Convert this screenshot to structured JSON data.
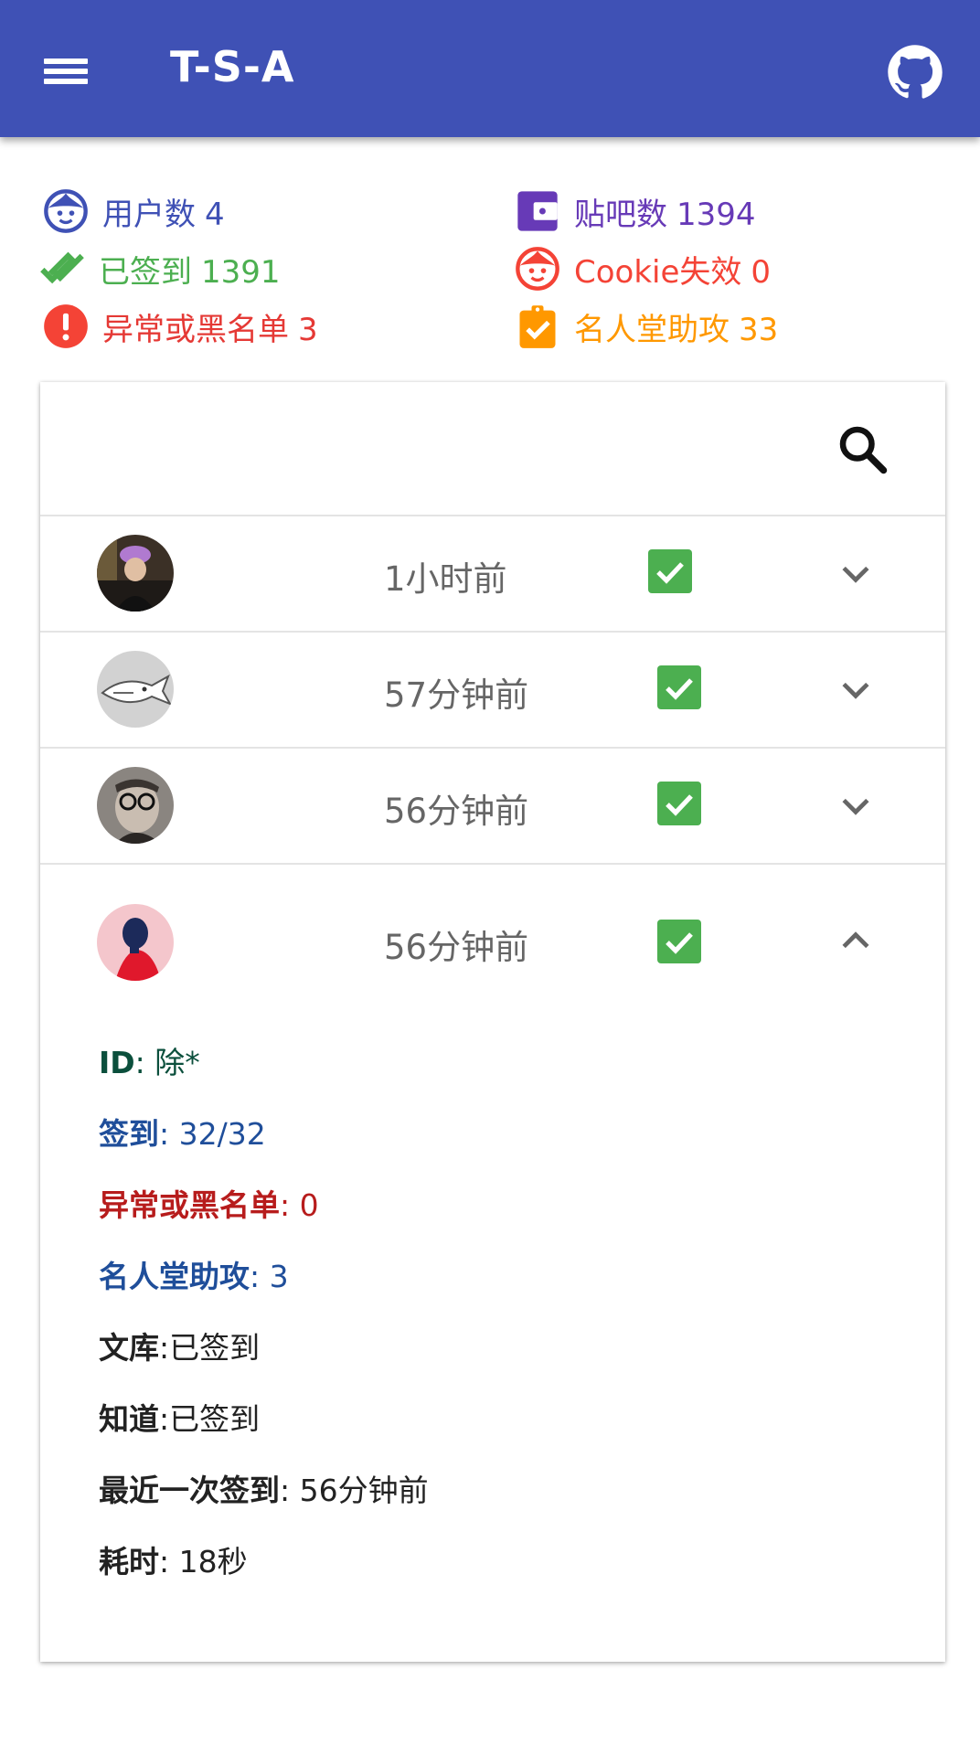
{
  "app": {
    "title": "T-S-A",
    "icons": {
      "menu": "hamburger-menu-icon",
      "repo": "github-icon"
    }
  },
  "colors": {
    "primary": "#3f51b5",
    "users": "#3f51b5",
    "forums": "#673ab7",
    "signed": "#4caf50",
    "cookie": "#f44336",
    "abnormal": "#e53935",
    "hall": "#ff9800",
    "check": "#4caf50"
  },
  "stats": {
    "users": {
      "label": "用户数",
      "value": "4",
      "icon": "face-icon"
    },
    "forums": {
      "label": "贴吧数",
      "value": "1394",
      "icon": "wallet-icon"
    },
    "signed": {
      "label": "已签到",
      "value": "1391",
      "icon": "double-check-icon"
    },
    "cookie_invalid": {
      "label": "Cookie失效",
      "value": "0",
      "icon": "face-icon"
    },
    "abnormal": {
      "label": "异常或黑名单",
      "value": "3",
      "icon": "alert-icon"
    },
    "hall_of_fame": {
      "label": "名人堂助攻",
      "value": "33",
      "icon": "clipboard-check-icon"
    }
  },
  "search": {
    "icon": "search-icon"
  },
  "users": [
    {
      "time": "1小时前",
      "signed": true,
      "expanded": false
    },
    {
      "time": "57分钟前",
      "signed": true,
      "expanded": false
    },
    {
      "time": "56分钟前",
      "signed": true,
      "expanded": false
    },
    {
      "time": "56分钟前",
      "signed": true,
      "expanded": true
    }
  ],
  "details": {
    "id": {
      "label": "ID",
      "value": ": 除*",
      "color": "#0b4f3c"
    },
    "sign": {
      "label": "签到",
      "value": ": 32/32",
      "color": "#1f4e9a"
    },
    "abnormal": {
      "label": "异常或黑名单",
      "value": ": 0",
      "color": "#b71c1c"
    },
    "hall": {
      "label": "名人堂助攻",
      "value": ": 3",
      "color": "#1f4e9a"
    },
    "wenku": {
      "label": "文库",
      "value": ":已签到"
    },
    "zhidao": {
      "label": "知道",
      "value": ":已签到"
    },
    "last": {
      "label": "最近一次签到",
      "value": ": 56分钟前"
    },
    "duration": {
      "label": "耗时",
      "value": ": 18秒"
    }
  }
}
